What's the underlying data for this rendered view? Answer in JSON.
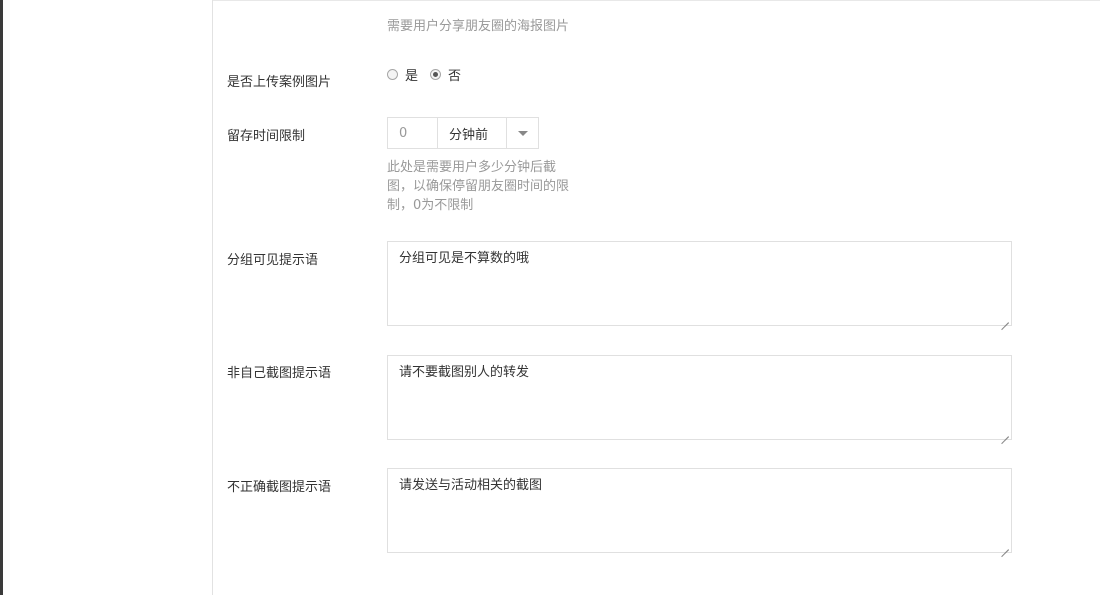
{
  "form": {
    "poster_help": "需要用户分享朋友圈的海报图片",
    "upload_case": {
      "label": "是否上传案例图片",
      "options": [
        "是",
        "否"
      ],
      "selected": "否"
    },
    "retention": {
      "label": "留存时间限制",
      "value": "0",
      "unit": "分钟前",
      "help_lines": [
        "此处是需要用户多少分钟后截",
        "图，以确保停留朋友圈时间的限",
        "制，0为不限制"
      ]
    },
    "group_visible_prompt": {
      "label": "分组可见提示语",
      "value": "分组可见是不算数的哦"
    },
    "not_self_screenshot_prompt": {
      "label": "非自己截图提示语",
      "value": "请不要截图别人的转发"
    },
    "incorrect_screenshot_prompt": {
      "label": "不正确截图提示语",
      "value": "请发送与活动相关的截图"
    }
  }
}
